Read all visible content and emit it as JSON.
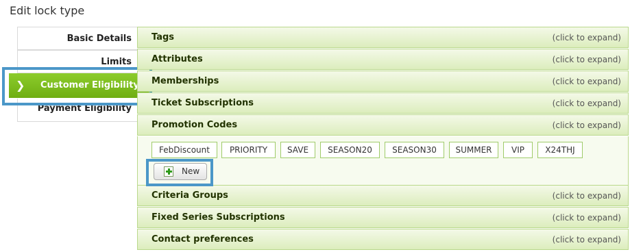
{
  "page": {
    "title": "Edit lock type"
  },
  "nav": {
    "items": [
      {
        "label": "Basic Details"
      },
      {
        "label": "Limits"
      },
      {
        "label": "Customer Eligibility",
        "active": true
      },
      {
        "label": "Payment Eligibility"
      }
    ],
    "active_chevron": "❯"
  },
  "accordion": {
    "expand_hint": "(click to expand)",
    "sections": [
      {
        "title": "Tags"
      },
      {
        "title": "Attributes"
      },
      {
        "title": "Memberships"
      },
      {
        "title": "Ticket Subscriptions"
      },
      {
        "title": "Promotion Codes",
        "expanded": true
      },
      {
        "title": "Criteria Groups"
      },
      {
        "title": "Fixed Series Subscriptions"
      },
      {
        "title": "Contact preferences"
      }
    ]
  },
  "promotion_codes": {
    "tags": [
      "FebDiscount",
      "PRIORITY",
      "SAVE",
      "SEASON20",
      "SEASON30",
      "SUMMER",
      "VIP",
      "X24THJ"
    ],
    "new_button_label": "New",
    "new_button_icon": "add-document-icon"
  },
  "colors": {
    "active_nav": "#7ab91c",
    "highlight_box": "#4b97c8",
    "section_border": "#b9d88a"
  }
}
